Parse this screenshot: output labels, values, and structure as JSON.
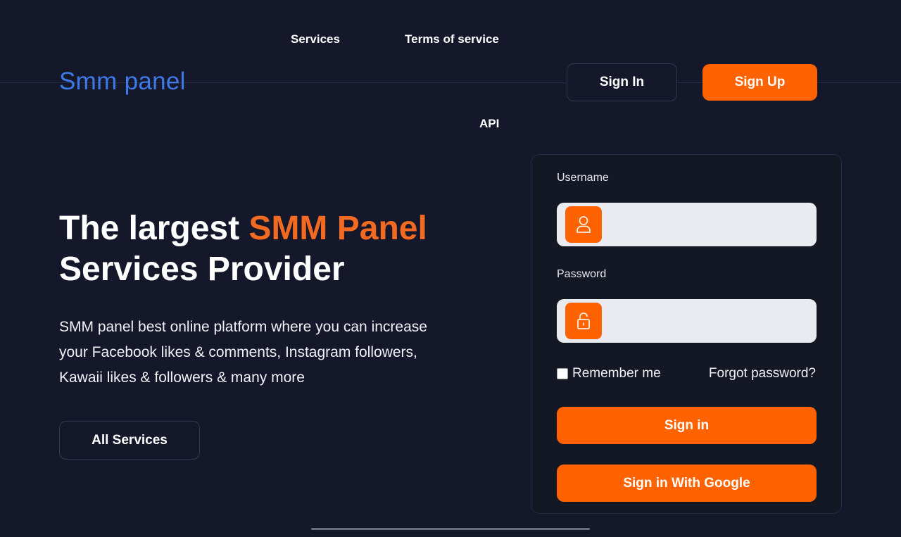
{
  "nav": {
    "services": "Services",
    "terms": "Terms of service",
    "api": "API"
  },
  "brand": "Smm panel",
  "header": {
    "sign_in": "Sign In",
    "sign_up": "Sign Up"
  },
  "hero": {
    "title_prefix": "The largest ",
    "title_accent": "SMM Panel",
    "title_line2": "Services Provider",
    "description": "SMM panel best online platform where you can increase your Facebook likes & comments, Instagram followers, Kawaii likes & followers & many more",
    "all_services": "All Services"
  },
  "login": {
    "username_label": "Username",
    "username_icon": "user-icon",
    "password_label": "Password",
    "password_icon": "lock-icon",
    "remember_me": "Remember me",
    "forgot_password": "Forgot password?",
    "sign_in": "Sign in",
    "sign_in_google": "Sign in With Google"
  },
  "colors": {
    "background": "#15172a",
    "accent": "#ff6200",
    "brand": "#3d7ae8"
  }
}
